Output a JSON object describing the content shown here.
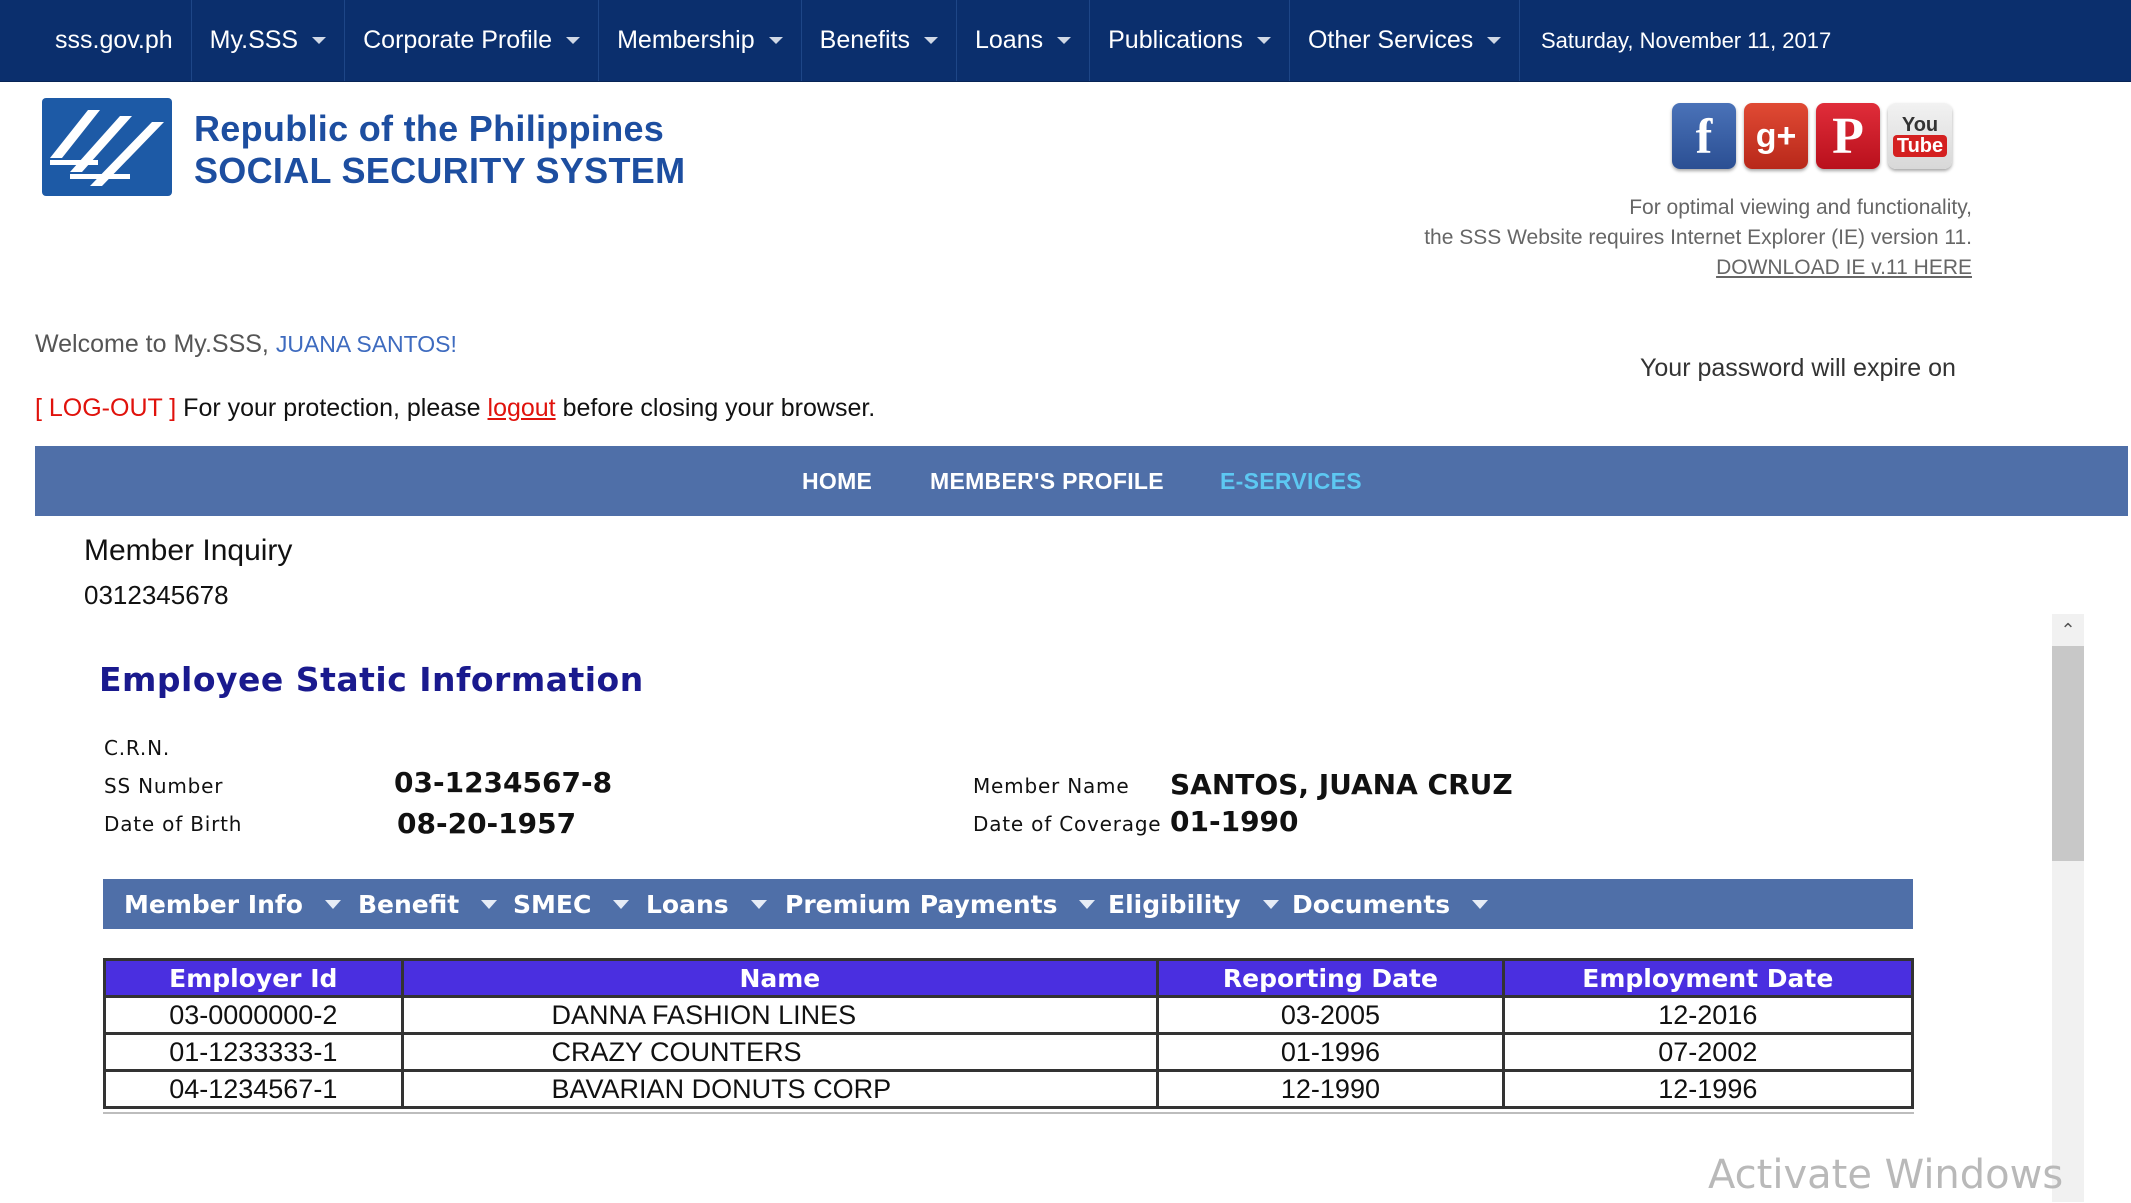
{
  "top_nav": {
    "items": [
      {
        "label": "sss.gov.ph",
        "has_caret": false
      },
      {
        "label": "My.SSS",
        "has_caret": true
      },
      {
        "label": "Corporate Profile",
        "has_caret": true
      },
      {
        "label": "Membership",
        "has_caret": true
      },
      {
        "label": "Benefits",
        "has_caret": true
      },
      {
        "label": "Loans",
        "has_caret": true
      },
      {
        "label": "Publications",
        "has_caret": true
      },
      {
        "label": "Other Services",
        "has_caret": true
      }
    ],
    "date": "Saturday, November 11, 2017"
  },
  "header": {
    "brand_line1": "Republic of the Philippines",
    "brand_line2": "SOCIAL SECURITY SYSTEM",
    "social_icons": [
      "facebook-icon",
      "google-plus-icon",
      "pinterest-icon",
      "youtube-icon"
    ],
    "social_glyphs": {
      "facebook": "f",
      "google_plus": "g+",
      "pinterest": "P",
      "youtube_top": "You",
      "youtube_bottom": "Tube"
    },
    "ie_note_line1": "For optimal viewing and functionality,",
    "ie_note_line2": "the SSS Website requires Internet Explorer (IE) version 11.",
    "ie_download_link": "DOWNLOAD IE v.11 HERE"
  },
  "welcome": {
    "prefix": "Welcome to My.SSS,",
    "user": "JUANA SANTOS!",
    "password_notice": "Your password will expire on",
    "logout_tag": "[ LOG-OUT ]",
    "logout_pre": " For your protection, please ",
    "logout_link": "logout",
    "logout_post": " before closing your browser."
  },
  "main_menu": {
    "items": [
      "HOME",
      "MEMBER'S PROFILE",
      "E-SERVICES"
    ],
    "active": "E-SERVICES"
  },
  "member_inquiry": {
    "title": "Member Inquiry",
    "id": "0312345678"
  },
  "employee_info": {
    "title": "Employee Static Information",
    "crn_label": "C.R.N.",
    "ss_number_label": "SS Number",
    "ss_number": "03-1234567-8",
    "dob_label": "Date of Birth",
    "dob": "08-20-1957",
    "member_name_label": "Member Name",
    "member_name": "SANTOS, JUANA CRUZ",
    "coverage_label": "Date of Coverage",
    "coverage": "01-1990"
  },
  "sub_menu": {
    "items": [
      "Member Info",
      "Benefit",
      "SMEC",
      "Loans",
      "Premium Payments",
      "Eligibility",
      "Documents"
    ]
  },
  "employment_table": {
    "headers": [
      "Employer Id",
      "Name",
      "Reporting Date",
      "Employment Date"
    ],
    "rows": [
      [
        "03-0000000-2",
        "DANNA FASHION LINES",
        "03-2005",
        "12-2016"
      ],
      [
        "01-1233333-1",
        "CRAZY COUNTERS",
        "01-1996",
        "07-2002"
      ],
      [
        "04-1234567-1",
        "BAVARIAN DONUTS CORP",
        "12-1990",
        "12-1996"
      ]
    ]
  },
  "watermark": "Activate Windows",
  "colors": {
    "top_nav_bg": "#0b2f6d",
    "menu_bg": "#4f6fa8",
    "active_menu": "#5dc8f2",
    "table_header_bg": "#4a2fe0",
    "logout_red": "#e0120c",
    "brand_blue": "#1d4ea0"
  }
}
